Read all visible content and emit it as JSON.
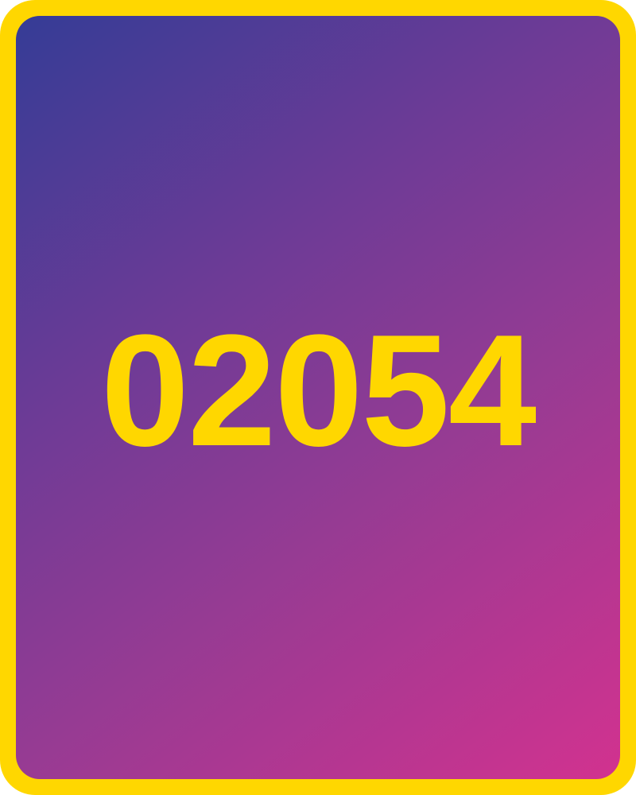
{
  "card": {
    "number": "02054",
    "border_color": "#FFD700",
    "text_color": "#FFD700",
    "gradient_colors": [
      "#353C96",
      "#6E3B96",
      "#973B93",
      "#D2328F"
    ]
  }
}
